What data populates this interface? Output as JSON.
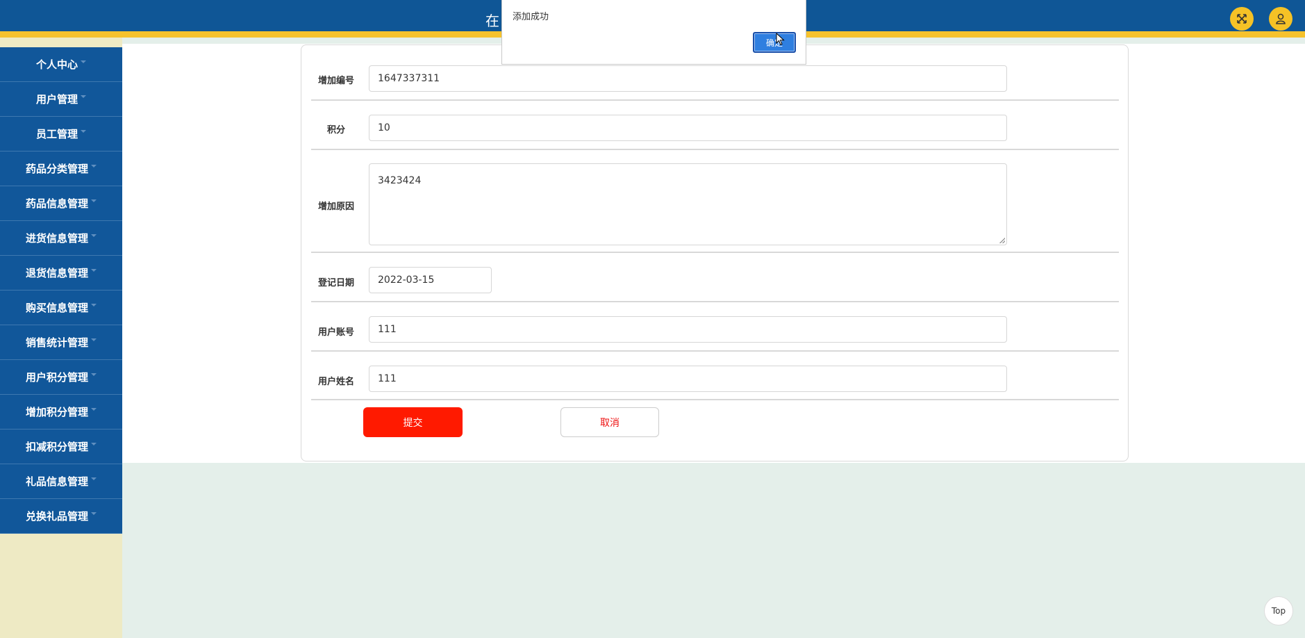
{
  "header": {
    "title": "在",
    "fullscreen_icon": "expand-icon",
    "user_icon": "user-icon"
  },
  "sidebar": {
    "items": [
      {
        "label": "个人中心"
      },
      {
        "label": "用户管理"
      },
      {
        "label": "员工管理"
      },
      {
        "label": "药品分类管理"
      },
      {
        "label": "药品信息管理"
      },
      {
        "label": "进货信息管理"
      },
      {
        "label": "退货信息管理"
      },
      {
        "label": "购买信息管理"
      },
      {
        "label": "销售统计管理"
      },
      {
        "label": "用户积分管理"
      },
      {
        "label": "增加积分管理"
      },
      {
        "label": "扣减积分管理"
      },
      {
        "label": "礼品信息管理"
      },
      {
        "label": "兑换礼品管理"
      }
    ]
  },
  "form": {
    "fields": [
      {
        "label": "增加编号",
        "value": "1647337311"
      },
      {
        "label": "积分",
        "value": "10"
      },
      {
        "label": "增加原因",
        "value": "3423424"
      },
      {
        "label": "登记日期",
        "value": "2022-03-15"
      },
      {
        "label": "用户账号",
        "value": "111"
      },
      {
        "label": "用户姓名",
        "value": "111"
      }
    ],
    "submit_label": "提交",
    "cancel_label": "取消"
  },
  "dialog": {
    "message": "添加成功",
    "ok_label": "确定"
  },
  "top_button": "Top",
  "colors": {
    "header_bg": "#0f5696",
    "header_accent": "#f6c22d",
    "sidebar_bg": "#11579a",
    "submit_bg": "#ff1a00"
  }
}
